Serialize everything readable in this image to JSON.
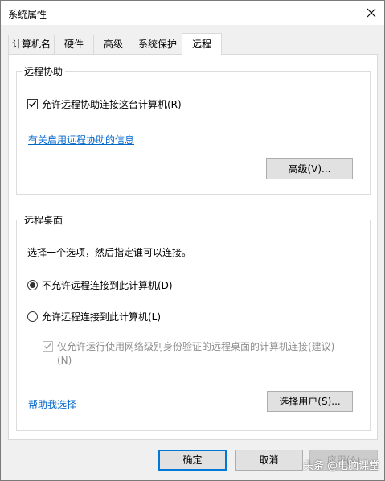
{
  "window": {
    "title": "系统属性"
  },
  "tabs": [
    {
      "label": "计算机名"
    },
    {
      "label": "硬件"
    },
    {
      "label": "高级"
    },
    {
      "label": "系统保护"
    },
    {
      "label": "远程"
    }
  ],
  "remote_assistance": {
    "title": "远程协助",
    "allow_label": "允许远程协助连接这台计算机(R)",
    "allow_checked": true,
    "info_link": "有关启用远程协助的信息",
    "advanced_button": "高级(V)..."
  },
  "remote_desktop": {
    "title": "远程桌面",
    "instruction": "选择一个选项，然后指定谁可以连接。",
    "option_deny": "不允许远程连接到此计算机(D)",
    "option_allow": "允许远程连接到此计算机(L)",
    "selected_option": "deny",
    "nla_label_line1": "仅允许运行使用网络级别身份验证的远程桌面的计算机连接(建议)",
    "nla_label_line2": "(N)",
    "nla_checked": true,
    "help_link": "帮助我选择",
    "select_users_button": "选择用户(S)..."
  },
  "footer": {
    "ok": "确定",
    "cancel": "取消",
    "apply": "应用(A)"
  },
  "watermark": {
    "text": "头条 @电脑课堂"
  }
}
